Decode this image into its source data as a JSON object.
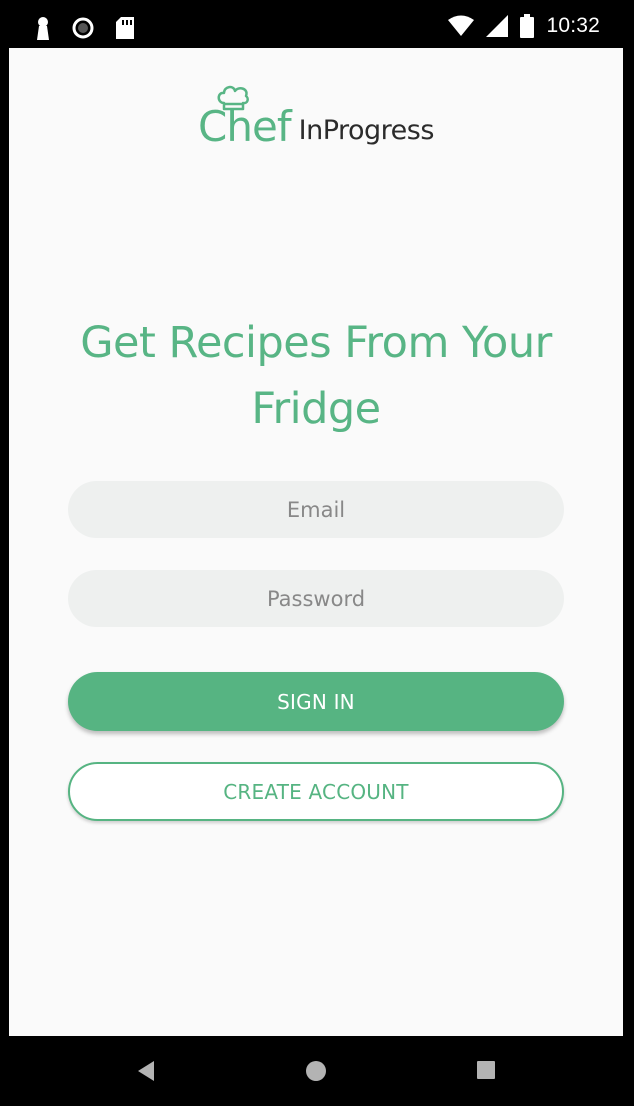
{
  "status_bar": {
    "time": "10:32",
    "icons": [
      "keyhole-icon",
      "sync-icon",
      "sd-card-icon",
      "wifi-icon",
      "cellular-icon",
      "battery-icon"
    ]
  },
  "logo": {
    "chef": "Chef",
    "inprogress": "InProgress",
    "hat_icon": "chef-hat-icon"
  },
  "headline": "Get Recipes From Your Fridge",
  "form": {
    "email_placeholder": "Email",
    "password_placeholder": "Password",
    "sign_in_label": "SIGN IN",
    "create_account_label": "CREATE ACCOUNT"
  },
  "nav_bar": {
    "icons": [
      "back-icon",
      "home-icon",
      "recents-icon"
    ]
  },
  "colors": {
    "accent": "#56b482",
    "field_bg": "#eef0ef",
    "screen_bg": "#fafafa"
  }
}
